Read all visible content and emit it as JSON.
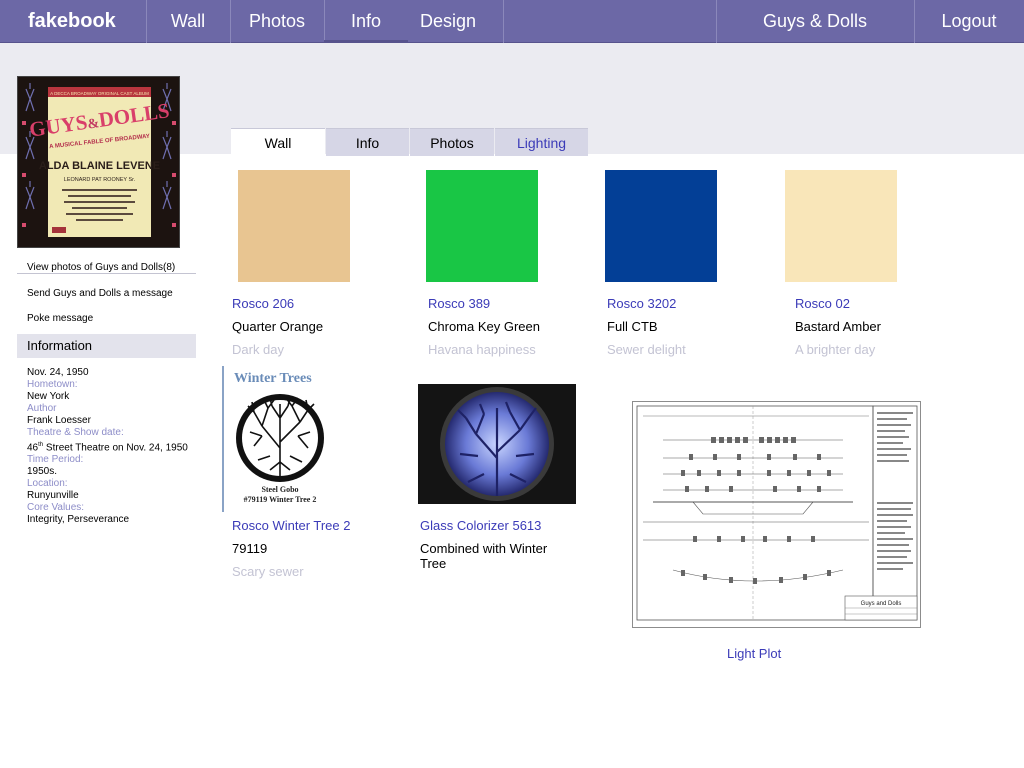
{
  "nav": {
    "logo": "fakebook",
    "wall": "Wall",
    "photos": "Photos",
    "info": "Info",
    "design": "Design",
    "group": "Guys & Dolls",
    "logout": "Logout"
  },
  "sidebar": {
    "view_photos": "View photos of Guys and Dolls(8)",
    "send_message": "Send Guys and Dolls a message",
    "poke": "Poke message",
    "information_heading": "Information",
    "date": "Nov. 24, 1950",
    "hometown_label": "Hometown:",
    "hometown": "New York",
    "author_label": "Author",
    "author": "Frank Loesser",
    "theatre_label": "Theatre & Show date:",
    "theatre_pre": "46",
    "theatre_sup": "th",
    "theatre_post": " Street Theatre on Nov. 24, 1950",
    "period_label": "Time Period:",
    "period": "1950s.",
    "location_label": "Location:",
    "location": "Runyunville",
    "values_label": "Core Values:",
    "values": "Integrity,  Perseverance"
  },
  "poster": {
    "decca": "A DECCA BROADWAY ORIGINAL CAST ALBUM",
    "title_guys": "GUYS",
    "title_amp": "&",
    "title_dolls": "DOLLS",
    "tagline": "A MUSICAL FABLE OF BROADWAY",
    "names_1": "ALDA  BLAINE  LEVENE",
    "names_2": "LEONARD  PAT ROONEY Sr."
  },
  "tabs": {
    "wall": "Wall",
    "info": "Info",
    "photos": "Photos",
    "lighting": "Lighting"
  },
  "colors": {
    "rosco206": "#e8c591",
    "rosco389": "#19c645",
    "rosco3202": "#033f96",
    "rosco02": "#f9e6b9"
  },
  "cards": [
    {
      "title": "Rosco 206",
      "sub": "Quarter Orange",
      "note": "Dark day"
    },
    {
      "title": "Rosco 389",
      "sub": "Chroma Key Green",
      "note": "Havana happiness"
    },
    {
      "title": "Rosco 3202",
      "sub": "Full CTB",
      "note": "Sewer delight"
    },
    {
      "title": "Rosco 02",
      "sub": "Bastard Amber",
      "note": "A brighter  day"
    }
  ],
  "gobo": {
    "image_title": "Winter Trees",
    "image_caption_1": "Steel Gobo",
    "image_caption_2": "#79119 Winter Tree 2",
    "title": "Rosco Winter Tree 2",
    "sub": "79119",
    "note": "Scary sewer"
  },
  "glass": {
    "title": "Glass Colorizer 5613",
    "sub": "Combined with  Winter Tree"
  },
  "plot": {
    "title": "Light Plot",
    "block_title": "Guys and Dolls"
  }
}
